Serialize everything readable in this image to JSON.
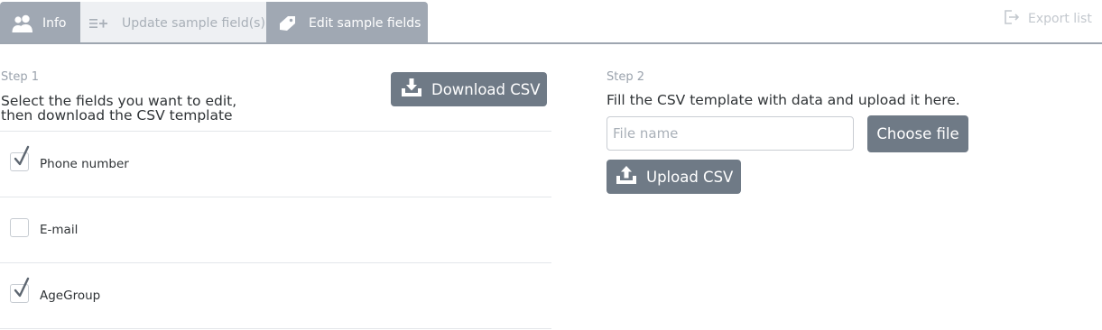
{
  "tabs": {
    "info": {
      "label": "Info",
      "icon": "users-icon"
    },
    "update": {
      "label": "Update sample field(s)",
      "icon": "list-add-icon"
    },
    "edit": {
      "label": "Edit sample fields",
      "icon": "tag-icon"
    }
  },
  "toolbar": {
    "export_label": "Export list",
    "export_icon": "export-icon"
  },
  "step1": {
    "label": "Step 1",
    "instruction_line1": "Select the fields you want to edit,",
    "instruction_line2": "then download the CSV template",
    "download_label": "Download CSV",
    "fields": [
      {
        "label": "Phone number",
        "checked": true
      },
      {
        "label": "E-mail",
        "checked": false
      },
      {
        "label": "AgeGroup",
        "checked": true
      }
    ]
  },
  "step2": {
    "label": "Step 2",
    "instruction": "Fill the CSV template with data and upload it here.",
    "file_placeholder": "File name",
    "file_value": "",
    "choose_label": "Choose file",
    "upload_label": "Upload CSV"
  },
  "colors": {
    "button": "#6f7a86",
    "tab_active": "#a0a8b3",
    "tab_inactive": "#eef0f3",
    "muted_text": "#9aa2ac"
  }
}
